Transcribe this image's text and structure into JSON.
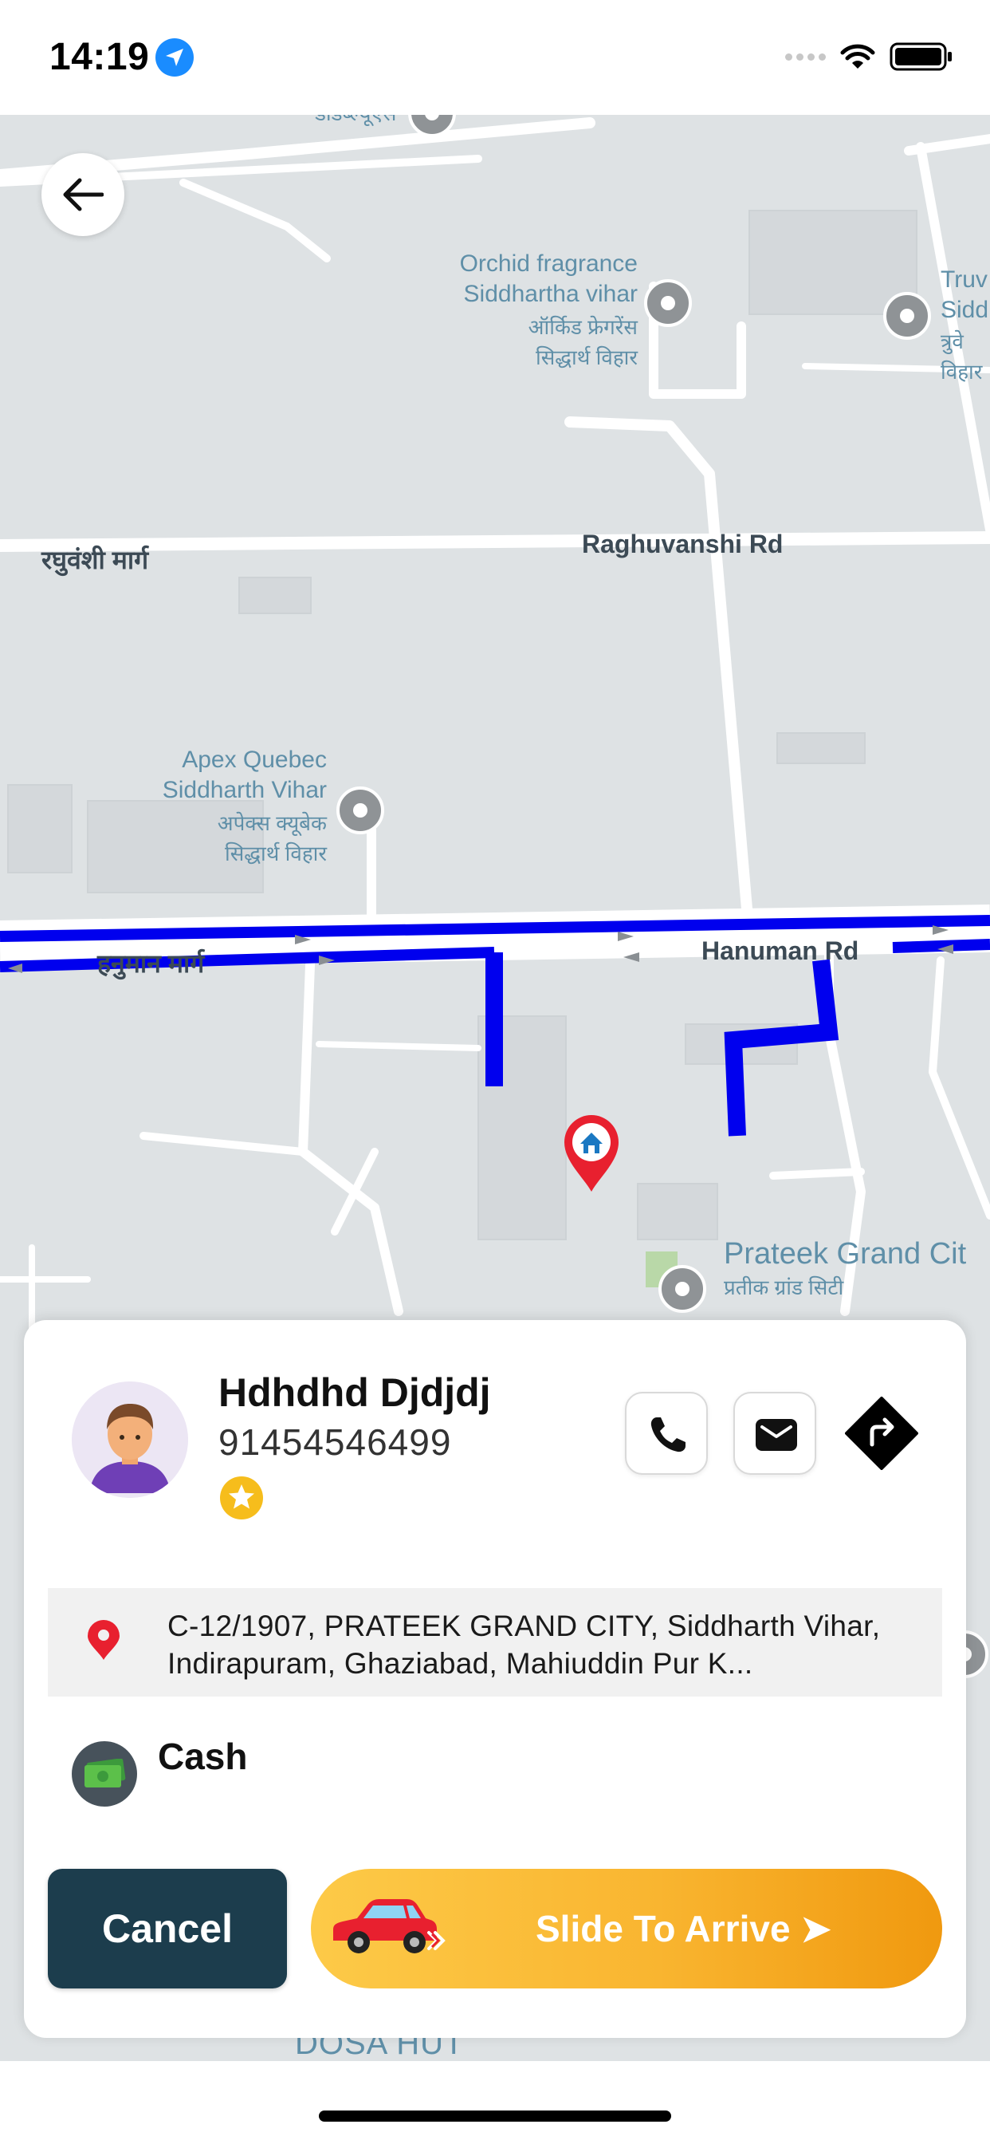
{
  "status_bar": {
    "time": "14:19",
    "icons": [
      "location-arrow-icon",
      "cellular-signal-icon",
      "wifi-icon",
      "battery-icon"
    ]
  },
  "map": {
    "poi_labels": [
      {
        "id": "top_cut",
        "text": "डीडब्ल्यूएस"
      },
      {
        "id": "orchid_en1",
        "text": "Orchid fragrance"
      },
      {
        "id": "orchid_en2",
        "text": "Siddhartha vihar"
      },
      {
        "id": "orchid_hi1",
        "text": "ऑर्किड फ्रेगरेंस"
      },
      {
        "id": "orchid_hi2",
        "text": "सिद्धार्थ विहार"
      },
      {
        "id": "truv1",
        "text": "Truv"
      },
      {
        "id": "truv2",
        "text": "Sidd"
      },
      {
        "id": "truv3",
        "text": "त्रुवे"
      },
      {
        "id": "truv4",
        "text": "विहार"
      },
      {
        "id": "apex_en1",
        "text": "Apex Quebec"
      },
      {
        "id": "apex_en2",
        "text": "Siddharth Vihar"
      },
      {
        "id": "apex_hi1",
        "text": "अपेक्स क्यूबेक"
      },
      {
        "id": "apex_hi2",
        "text": "सिद्धार्थ विहार"
      },
      {
        "id": "prateek_en",
        "text": "Prateek Grand Cit"
      },
      {
        "id": "prateek_hi",
        "text": "प्रतीक ग्रांड सिटी"
      }
    ],
    "road_labels": {
      "raghuvanshi_hi": "रघुवंशी मार्ग",
      "raghuvanshi_en": "Raghuvanshi Rd",
      "hanuman_hi": "हनुमान मार्ग",
      "hanuman_en": "Hanuman Rd"
    },
    "below_card_label": "DOSA HUT",
    "route_color": "#0000ee"
  },
  "rider": {
    "name": "Hdhdhd Djdjdj",
    "phone": "91454546499"
  },
  "trip": {
    "address": "C-12/1907, PRATEEK GRAND CITY, Siddharth Vihar, Indirapuram, Ghaziabad, Mahiuddin Pur K...",
    "payment_method": "Cash"
  },
  "actions": {
    "cancel_label": "Cancel",
    "slide_label": "Slide To Arrive ➤"
  },
  "colors": {
    "cancel_bg": "#1c3d4d",
    "slide_gradient_start": "#fdca48",
    "slide_gradient_end": "#f0990f",
    "star": "#f6bd1c",
    "pin_red": "#e8202f"
  }
}
